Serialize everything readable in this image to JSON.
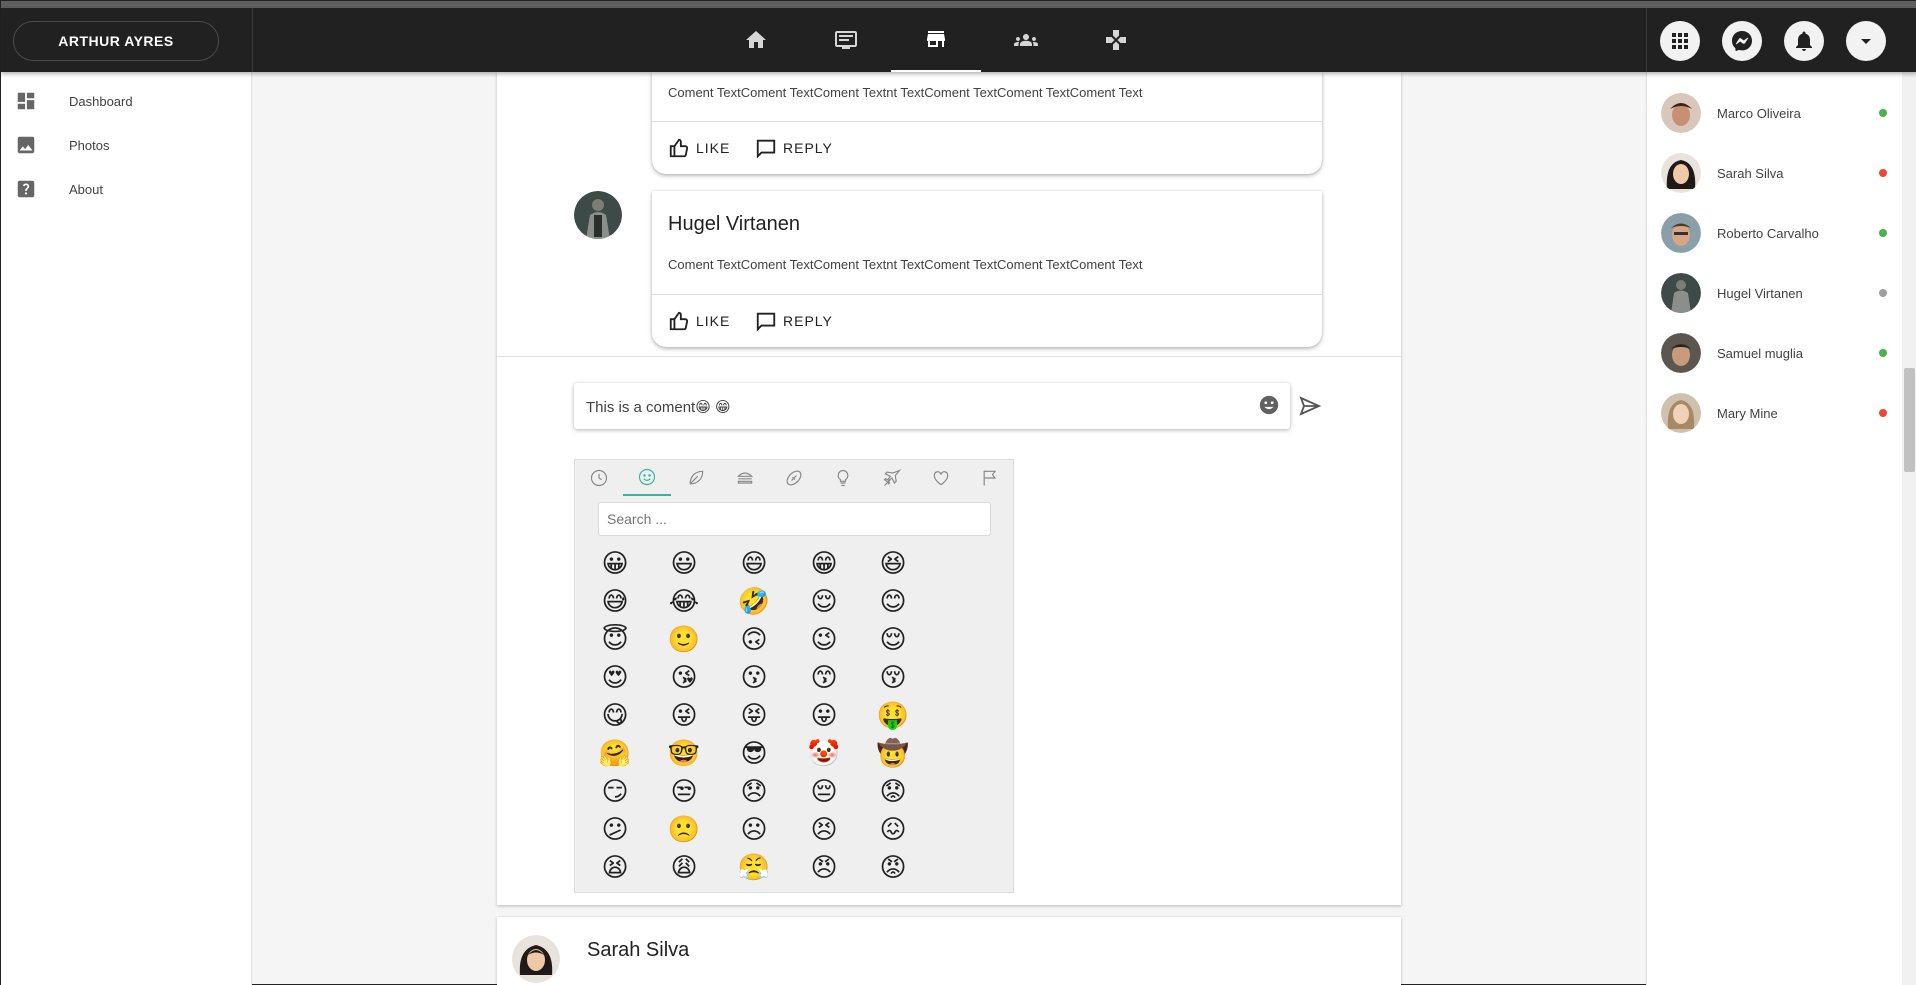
{
  "header": {
    "user_name": "ARTHUR AYRES",
    "nav_tabs": [
      {
        "icon": "home-icon",
        "active": false
      },
      {
        "icon": "monitor-icon",
        "active": false
      },
      {
        "icon": "store-icon",
        "active": true
      },
      {
        "icon": "people-icon",
        "active": false
      },
      {
        "icon": "gamepad-icon",
        "active": false
      }
    ],
    "actions": [
      "apps-grid-icon",
      "messenger-icon",
      "bell-icon",
      "arrow-drop-down-icon"
    ]
  },
  "sidebar": {
    "items": [
      {
        "label": "Dashboard",
        "icon": "dashboard-icon"
      },
      {
        "label": "Photos",
        "icon": "image-icon"
      },
      {
        "label": "About",
        "icon": "help-icon"
      }
    ]
  },
  "comments": [
    {
      "name": "",
      "text": "Coment TextComent TextComent Textnt TextComent TextComent TextComent Text",
      "like_label": "LIKE",
      "reply_label": "REPLY"
    },
    {
      "name": "Hugel Virtanen",
      "text": "Coment TextComent TextComent Textnt TextComent TextComent TextComent Text",
      "like_label": "LIKE",
      "reply_label": "REPLY"
    }
  ],
  "comment_input": {
    "value": "This is a coment😁 😁"
  },
  "emoji_picker": {
    "categories": [
      "clock-icon",
      "smiley-icon",
      "leaf-icon",
      "burger-icon",
      "football-icon",
      "lightbulb-icon",
      "plane-icon",
      "heart-icon",
      "flag-icon"
    ],
    "active_category": 1,
    "search_placeholder": "Search ...",
    "emojis": [
      "😀",
      "😃",
      "😄",
      "😁",
      "😆",
      "😅",
      "😂",
      "🤣",
      "😌",
      "😊",
      "😇",
      "🙂",
      "🙃",
      "😉",
      "😌",
      "😍",
      "😘",
      "😗",
      "😙",
      "😚",
      "😋",
      "😜",
      "😝",
      "😛",
      "🤑",
      "🤗",
      "🤓",
      "😎",
      "🤡",
      "🤠",
      "😏",
      "😒",
      "😞",
      "😔",
      "😟",
      "😕",
      "🙁",
      "☹",
      "😣",
      "😖",
      "😫",
      "😩",
      "😤",
      "😠",
      "😡"
    ]
  },
  "contacts": [
    {
      "name": "Marco Oliveira",
      "status_color": "#4caf50"
    },
    {
      "name": "Sarah Silva",
      "status_color": "#f44336"
    },
    {
      "name": "Roberto Carvalho",
      "status_color": "#4caf50"
    },
    {
      "name": "Hugel Virtanen",
      "status_color": "#9e9e9e"
    },
    {
      "name": "Samuel muglia",
      "status_color": "#4caf50"
    },
    {
      "name": "Mary Mine",
      "status_color": "#f44336"
    }
  ],
  "next_post": {
    "author": "Sarah Silva"
  },
  "colors": {
    "appbar": "#212121",
    "accent": "#35b6a0",
    "online": "#4caf50",
    "busy": "#f44336",
    "away": "#9e9e9e"
  }
}
